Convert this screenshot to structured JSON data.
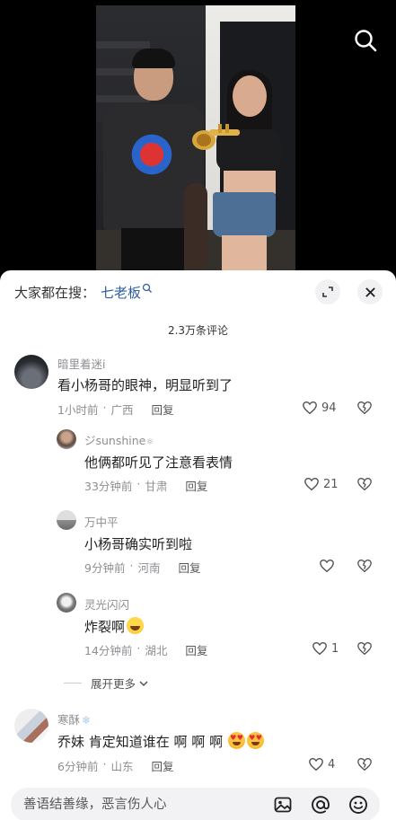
{
  "hot_search": {
    "prefix": "大家都在搜：",
    "keyword": "七老板",
    "keyword_icon": "search-small-icon"
  },
  "comment_count": "2.3万条评论",
  "comments": [
    {
      "username": "暗里着迷i",
      "text": "看小杨哥的眼神，明显听到了",
      "time": "1小时前",
      "location": "广西",
      "reply": "回复",
      "likes": "94",
      "avatar": "dark-landscape"
    },
    {
      "username": "ジsunshine",
      "username_icon": "sun-badge-icon",
      "text": "他俩都听见了注意看表情",
      "time": "33分钟前",
      "location": "甘肃",
      "reply": "回复",
      "likes": "21",
      "avatar": "person-portrait"
    },
    {
      "username": "万中平",
      "text": "小杨哥确实听到啦",
      "time": "9分钟前",
      "location": "河南",
      "reply": "回复",
      "likes": "",
      "avatar": "grey-landscape"
    },
    {
      "username": "灵光闪闪",
      "text": "炸裂啊",
      "emoji": [
        "laughing-tears-emoji"
      ],
      "time": "14分钟前",
      "location": "湖北",
      "reply": "回复",
      "likes": "1",
      "avatar": "dog-portrait"
    },
    {
      "username": "寒酥",
      "username_icon": "snowflake-icon",
      "text": "乔妹 肯定知道谁在 啊 啊 啊",
      "emoji": [
        "heart-eyes-emoji",
        "heart-eyes-emoji"
      ],
      "time": "6分钟前",
      "location": "山东",
      "reply": "回复",
      "likes": "4",
      "avatar": "room-photo"
    }
  ],
  "expand_more": "展开更多",
  "input": {
    "placeholder": "善语结善缘，恶言伤人心"
  },
  "colors": {
    "accent_link": "#2d5e9e",
    "muted_text": "#8e8e93",
    "sheet_bg": "#ffffff",
    "input_bg": "#f2f2f4"
  }
}
